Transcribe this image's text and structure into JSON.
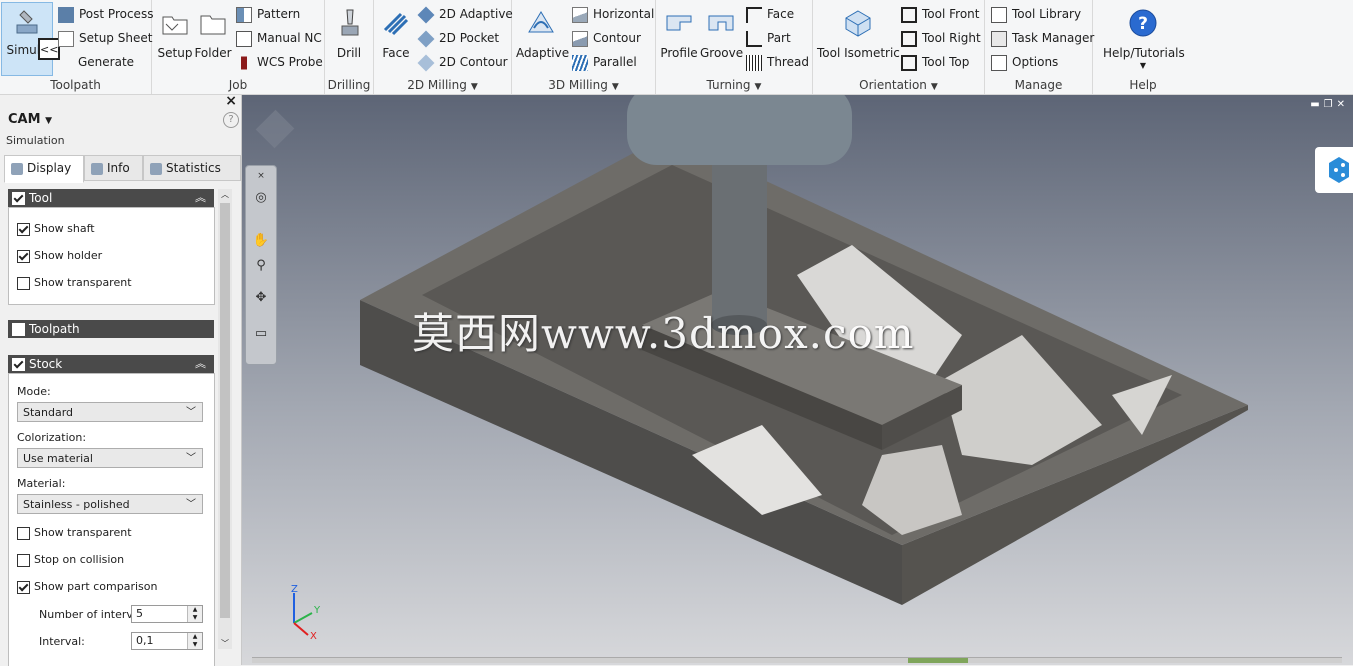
{
  "ribbon": {
    "toolpath": {
      "label": "Toolpath",
      "simulate_label": "Simula",
      "collapse_label": "<<",
      "post_process": "Post Process",
      "setup_sheet": "Setup Sheet",
      "generate": "Generate"
    },
    "job": {
      "label": "Job",
      "setup": "Setup",
      "folder": "Folder",
      "pattern": "Pattern",
      "manual_nc": "Manual NC",
      "wcs_probe": "WCS Probe"
    },
    "drilling": {
      "label": "Drilling",
      "drill": "Drill"
    },
    "milling2d": {
      "label": "2D Milling",
      "face": "Face",
      "adaptive": "2D Adaptive",
      "pocket": "2D Pocket",
      "contour": "2D Contour"
    },
    "milling3d": {
      "label": "3D Milling",
      "adaptive": "Adaptive",
      "horizontal": "Horizontal",
      "contour": "Contour",
      "parallel": "Parallel"
    },
    "turning": {
      "label": "Turning",
      "profile": "Profile",
      "groove": "Groove",
      "face": "Face",
      "part": "Part",
      "thread": "Thread"
    },
    "orientation": {
      "label": "Orientation",
      "tool_isometric": "Tool Isometric",
      "tool_front": "Tool Front",
      "tool_right": "Tool Right",
      "tool_top": "Tool Top"
    },
    "manage": {
      "label": "Manage",
      "tool_library": "Tool Library",
      "task_manager": "Task Manager",
      "options": "Options"
    },
    "help": {
      "label": "Help",
      "help_tutorials": "Help/Tutorials"
    }
  },
  "panel": {
    "title": "CAM",
    "subtitle": "Simulation",
    "help_glyph": "?",
    "close_glyph": "×",
    "tabs": [
      {
        "label": "Display"
      },
      {
        "label": "Info"
      },
      {
        "label": "Statistics"
      }
    ],
    "tool_section": {
      "title": "Tool",
      "checked": true,
      "options": [
        {
          "label": "Show shaft",
          "checked": true
        },
        {
          "label": "Show holder",
          "checked": true
        },
        {
          "label": "Show transparent",
          "checked": false
        }
      ]
    },
    "toolpath_section": {
      "title": "Toolpath",
      "checked": false
    },
    "stock_section": {
      "title": "Stock",
      "checked": true,
      "mode_label": "Mode:",
      "mode_value": "Standard",
      "colorization_label": "Colorization:",
      "colorization_value": "Use material",
      "material_label": "Material:",
      "material_value": "Stainless - polished",
      "show_transparent": {
        "label": "Show transparent",
        "checked": false
      },
      "stop_on_collision": {
        "label": "Stop on collision",
        "checked": false
      },
      "show_part_comparison": {
        "label": "Show part comparison",
        "checked": true
      },
      "intervals_label": "Number of intervals",
      "intervals_value": "5",
      "interval_label": "Interval:",
      "interval_value": "0,1"
    }
  },
  "viewport": {
    "watermark": "莫西网www.3dmox.com",
    "triad": {
      "z": "Z",
      "y": "Y",
      "x": "X"
    },
    "colors": {
      "x": "#e02020",
      "y": "#2bb34a",
      "z": "#2060e0"
    }
  }
}
